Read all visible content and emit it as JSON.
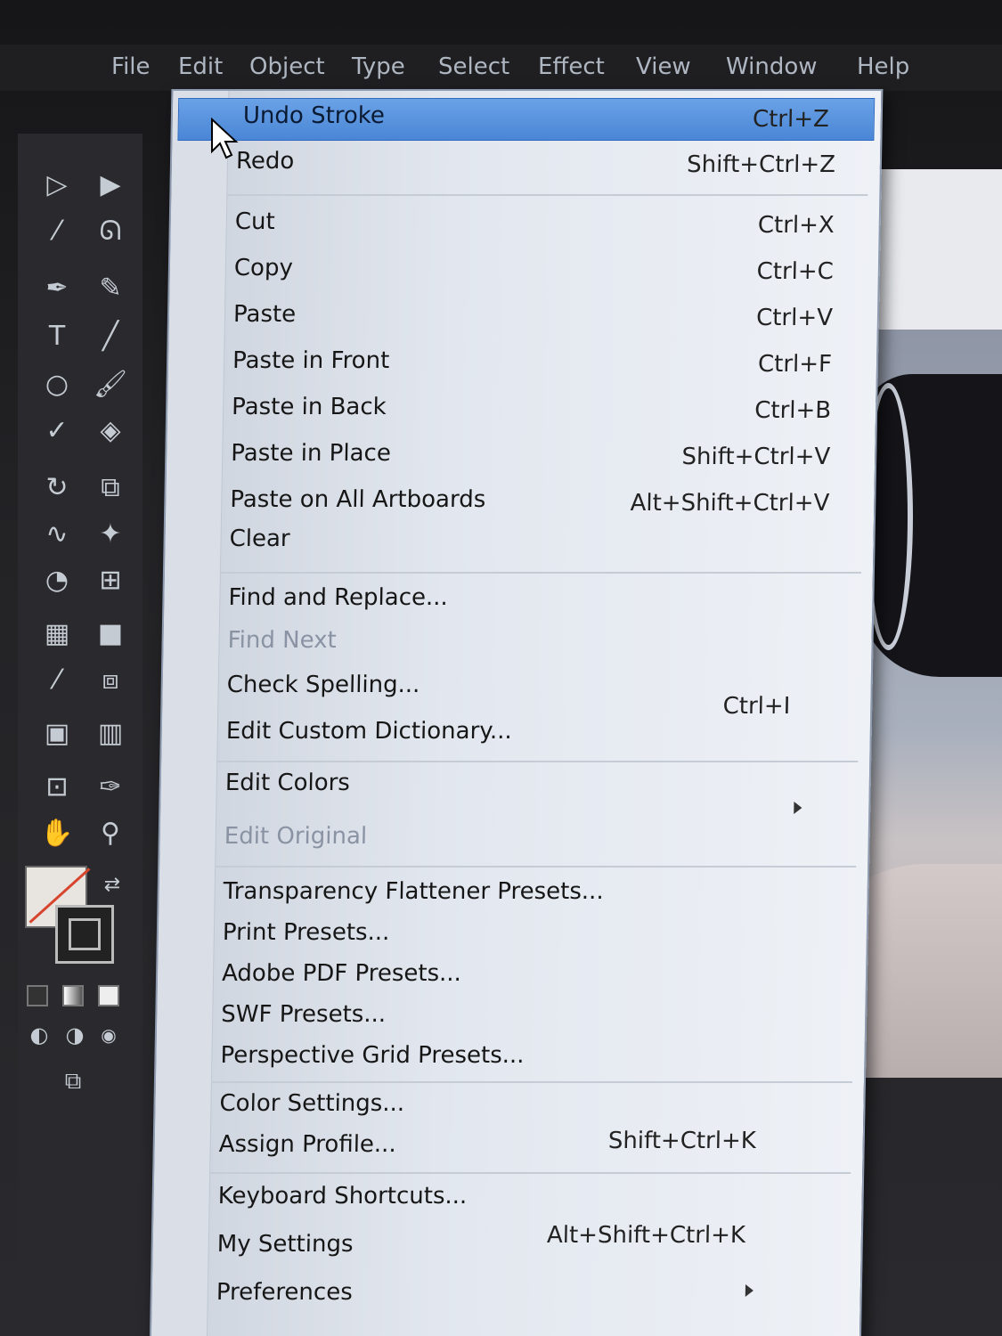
{
  "menubar": {
    "items": [
      "File",
      "Edit",
      "Object",
      "Type",
      "Select",
      "Effect",
      "View",
      "Window",
      "Help"
    ]
  },
  "edit_menu": {
    "items": [
      {
        "label": "Undo Stroke",
        "shortcut": "Ctrl+Z",
        "highlighted": true
      },
      {
        "label": "Redo",
        "shortcut": "Shift+Ctrl+Z"
      },
      {
        "label": "Cut",
        "shortcut": "Ctrl+X"
      },
      {
        "label": "Copy",
        "shortcut": "Ctrl+C"
      },
      {
        "label": "Paste",
        "shortcut": "Ctrl+V"
      },
      {
        "label": "Paste in Front",
        "shortcut": "Ctrl+F"
      },
      {
        "label": "Paste in Back",
        "shortcut": "Ctrl+B"
      },
      {
        "label": "Paste in Place",
        "shortcut": "Shift+Ctrl+V"
      },
      {
        "label": "Paste on All Artboards",
        "shortcut": "Alt+Shift+Ctrl+V"
      },
      {
        "label": "Clear",
        "shortcut": ""
      },
      {
        "label": "Find and Replace...",
        "shortcut": ""
      },
      {
        "label": "Find Next",
        "shortcut": "",
        "disabled": true
      },
      {
        "label": "Check Spelling...",
        "shortcut": "Ctrl+I"
      },
      {
        "label": "Edit Custom Dictionary...",
        "shortcut": ""
      },
      {
        "label": "Edit Colors",
        "shortcut": "",
        "submenu": true
      },
      {
        "label": "Edit Original",
        "shortcut": "",
        "disabled": true
      },
      {
        "label": "Transparency Flattener Presets...",
        "shortcut": ""
      },
      {
        "label": "Print Presets...",
        "shortcut": ""
      },
      {
        "label": "Adobe PDF Presets...",
        "shortcut": ""
      },
      {
        "label": "SWF Presets...",
        "shortcut": ""
      },
      {
        "label": "Perspective Grid Presets...",
        "shortcut": ""
      },
      {
        "label": "Color Settings...",
        "shortcut": "Shift+Ctrl+K"
      },
      {
        "label": "Assign Profile...",
        "shortcut": ""
      },
      {
        "label": "Keyboard Shortcuts...",
        "shortcut": "Alt+Shift+Ctrl+K"
      },
      {
        "label": "My Settings",
        "shortcut": "",
        "submenu": true
      },
      {
        "label": "Preferences",
        "shortcut": "",
        "submenu": true
      }
    ]
  },
  "colors": {
    "highlight": "#4a86d6",
    "menu_bg": "#e2e7ef",
    "disabled_text": "#8a93a3",
    "fill_swatch_slash": "#d8452e"
  },
  "tool_icons": [
    "selection-tool-icon",
    "direct-selection-tool-icon",
    "magic-wand-icon",
    "lasso-icon",
    "pen-tool-icon",
    "curvature-tool-icon",
    "type-tool-icon",
    "line-segment-icon",
    "ellipse-tool-icon",
    "paintbrush-icon",
    "shaper-tool-icon",
    "eraser-icon",
    "rotate-tool-icon",
    "scale-tool-icon",
    "warp-tool-icon",
    "puppet-warp-icon",
    "shape-builder-icon",
    "perspective-grid-icon",
    "mesh-tool-icon",
    "gradient-tool-icon",
    "eyedropper-icon",
    "blend-tool-icon",
    "symbol-sprayer-icon",
    "graph-tool-icon",
    "artboard-tool-icon",
    "slice-tool-icon",
    "hand-tool-icon",
    "zoom-tool-icon"
  ]
}
